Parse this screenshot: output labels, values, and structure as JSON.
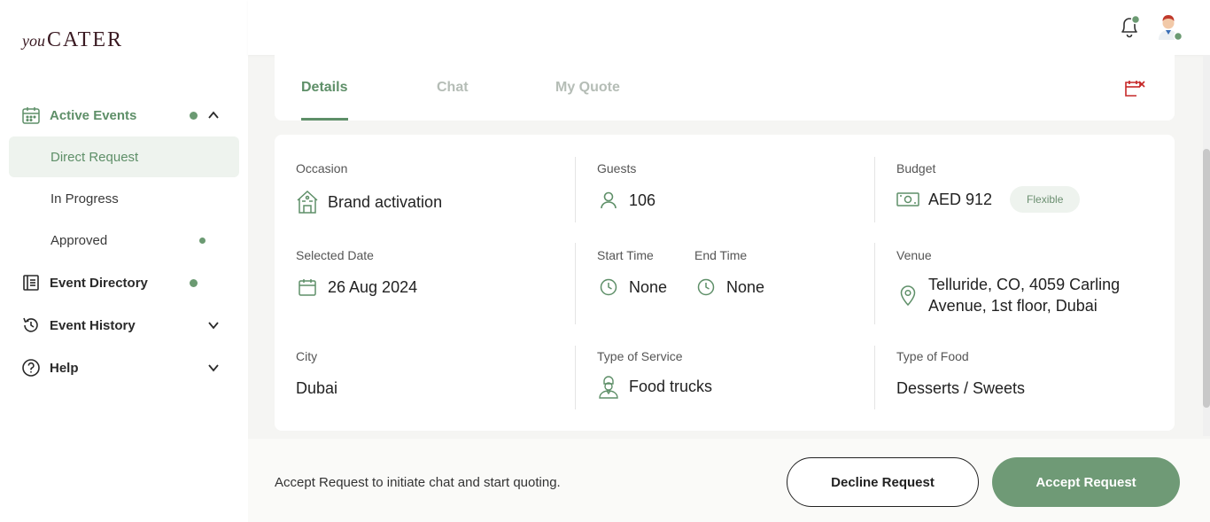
{
  "logo": {
    "you": "you",
    "cater": "CATER"
  },
  "sidebar": {
    "active_events": "Active Events",
    "direct_request": "Direct Request",
    "in_progress": "In Progress",
    "approved": "Approved",
    "event_directory": "Event Directory",
    "event_history": "Event History",
    "help": "Help"
  },
  "tabs": {
    "details": "Details",
    "chat": "Chat",
    "my_quote": "My Quote"
  },
  "details": {
    "occasion_label": "Occasion",
    "occasion_value": "Brand activation",
    "guests_label": "Guests",
    "guests_value": "106",
    "budget_label": "Budget",
    "budget_value": "AED 912",
    "budget_badge": "Flexible",
    "selected_date_label": "Selected Date",
    "selected_date_value": "26 Aug 2024",
    "start_time_label": "Start Time",
    "start_time_value": "None",
    "end_time_label": "End Time",
    "end_time_value": "None",
    "venue_label": "Venue",
    "venue_line1": "Telluride, CO, 4059 Carling",
    "venue_line2": "Avenue, 1st floor, Dubai",
    "city_label": "City",
    "city_value": "Dubai",
    "service_label": "Type of Service",
    "service_value": "Food trucks",
    "food_label": "Type of Food",
    "food_value": "Desserts / Sweets"
  },
  "footer": {
    "message": "Accept Request to initiate chat and start quoting.",
    "decline": "Decline Request",
    "accept": "Accept Request"
  },
  "colors": {
    "accent": "#5e8f68",
    "accent_button": "#6f9a76",
    "danger": "#c62828"
  }
}
